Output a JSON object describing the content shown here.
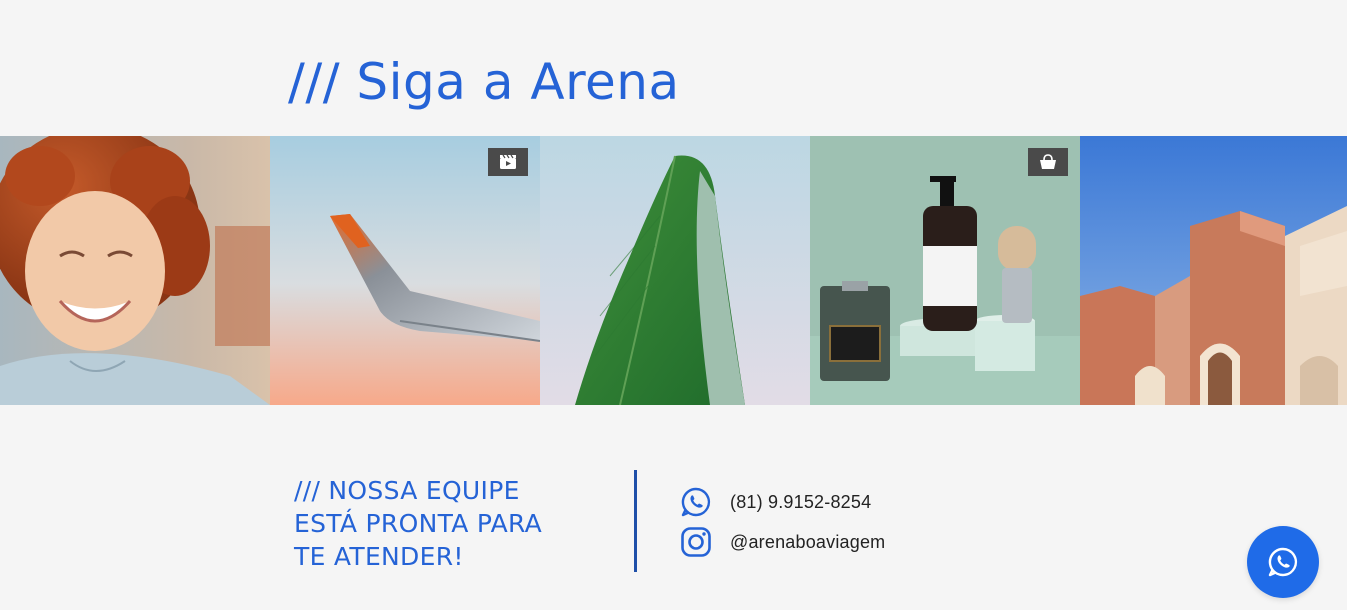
{
  "section": {
    "title": "/// Siga a Arena"
  },
  "gallery": {
    "tiles": [
      {
        "name": "gallery-photo-woman-laughing",
        "badge": null
      },
      {
        "name": "gallery-photo-airplane-wing",
        "badge": "video-reel-icon"
      },
      {
        "name": "gallery-photo-banana-leaf",
        "badge": null
      },
      {
        "name": "gallery-photo-grooming-products",
        "badge": "shopping-bag-icon"
      },
      {
        "name": "gallery-photo-building",
        "badge": null
      }
    ]
  },
  "contact": {
    "tagline_line1": "/// NOSSA EQUIPE",
    "tagline_line2": "ESTÁ PRONTA PARA",
    "tagline_line3": "TE ATENDER!",
    "phone": "(81) 9.9152-8254",
    "phone_icon": "whatsapp-icon",
    "instagram": "@arenaboaviagem",
    "instagram_icon": "instagram-icon"
  },
  "floating": {
    "icon": "whatsapp-icon"
  },
  "colors": {
    "accent": "#2563d6",
    "divider": "#1e4fa8",
    "fab": "#1f6be8",
    "background": "#f5f5f5"
  }
}
